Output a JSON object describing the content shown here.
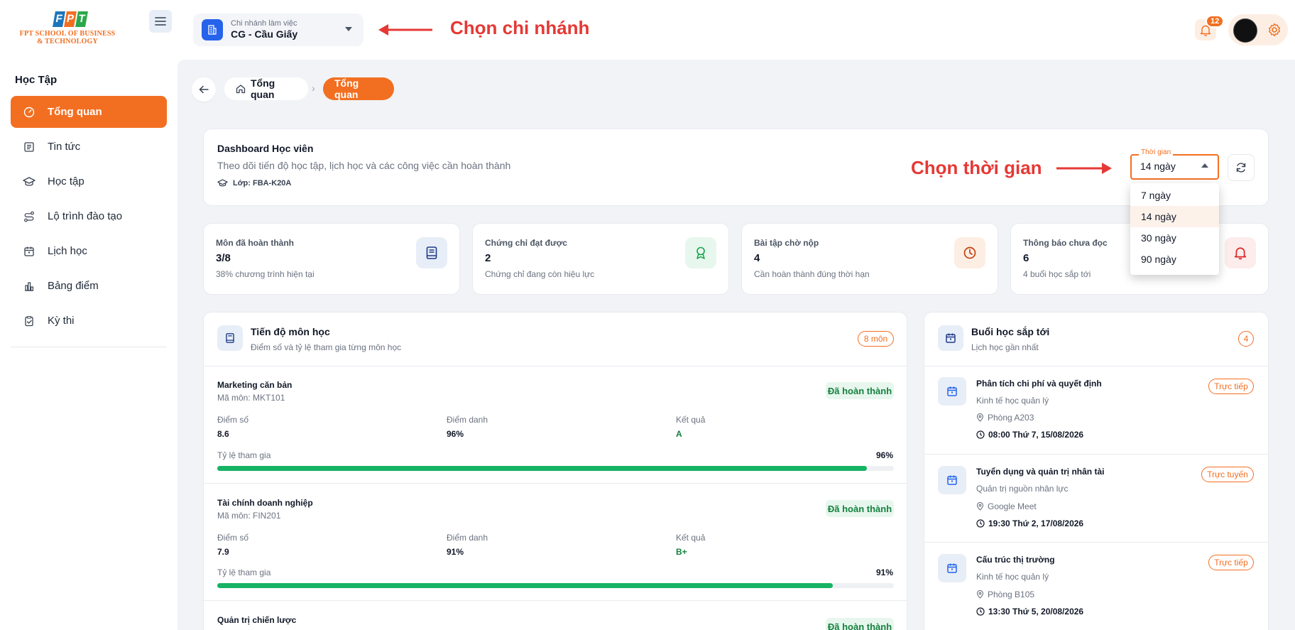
{
  "brand": {
    "logo_letters": [
      "F",
      "P",
      "T"
    ],
    "logo_letter_colors": [
      "#1b75bc",
      "#f26f21",
      "#2aa84a"
    ],
    "logo_text_line1": "FPT SCHOOL OF BUSINESS",
    "logo_text_line2": "& TECHNOLOGY"
  },
  "sidebar": {
    "section_title": "Học Tập",
    "items": [
      {
        "label": "Tổng quan",
        "icon": "gauge-icon",
        "active": true
      },
      {
        "label": "Tin tức",
        "icon": "news-icon"
      },
      {
        "label": "Học tập",
        "icon": "graduation-cap-icon"
      },
      {
        "label": "Lộ trình đào tạo",
        "icon": "route-icon"
      },
      {
        "label": "Lịch học",
        "icon": "calendar-icon"
      },
      {
        "label": "Bảng điểm",
        "icon": "bar-chart-icon"
      },
      {
        "label": "Kỳ thi",
        "icon": "clipboard-check-icon"
      }
    ]
  },
  "header": {
    "branch_label": "Chi nhánh làm việc",
    "branch_value": "CG - Cầu Giấy",
    "annotation_branch": "Chọn chi nhánh",
    "notification_count": "12"
  },
  "breadcrumb": {
    "home": "Tổng quan",
    "current": "Tổng quan"
  },
  "dashboard": {
    "title": "Dashboard Học viên",
    "subtitle": "Theo dõi tiến độ học tập, lịch học và các công việc cần hoàn thành",
    "class_label": "Lớp: FBA-K20A",
    "annotation_time": "Chọn thời gian",
    "time_legend": "Thời gian",
    "time_value": "14 ngày",
    "time_options": [
      "7 ngày",
      "14 ngày",
      "30 ngày",
      "90 ngày"
    ]
  },
  "stats": [
    {
      "label": "Môn đã hoàn thành",
      "value": "3/8",
      "desc": "38% chương trình hiện tại",
      "icon": "book-icon",
      "color": "#2563eb",
      "bg": "#e8eef7"
    },
    {
      "label": "Chứng chỉ đạt được",
      "value": "2",
      "desc": "Chứng chỉ đang còn hiệu lực",
      "icon": "award-icon",
      "color": "#16a34a",
      "bg": "#e7f7ee"
    },
    {
      "label": "Bài tập chờ nộp",
      "value": "4",
      "desc": "Cần hoàn thành đúng thời hạn",
      "icon": "clock-icon",
      "color": "#c2410c",
      "bg": "#fdeee4"
    },
    {
      "label": "Thông báo chưa đọc",
      "value": "6",
      "desc": "4 buổi học sắp tới",
      "icon": "bell-icon",
      "color": "#dc2626",
      "bg": "#fdecec"
    }
  ],
  "progress_panel": {
    "title": "Tiến độ môn học",
    "subtitle": "Điểm số và tỷ lệ tham gia từng môn học",
    "count_badge": "8 môn",
    "score_label": "Điểm số",
    "attendance_label": "Điểm danh",
    "result_label": "Kết quả",
    "participation_label": "Tỷ lệ tham gia",
    "courses": [
      {
        "name": "Marketing căn bản",
        "code": "Mã môn: MKT101",
        "status": "Đã hoàn thành",
        "score": "8.6",
        "attendance": "96%",
        "result": "A",
        "participation": "96%",
        "participation_value": 0.96
      },
      {
        "name": "Tài chính doanh nghiệp",
        "code": "Mã môn: FIN201",
        "status": "Đã hoàn thành",
        "score": "7.9",
        "attendance": "91%",
        "result": "B+",
        "participation": "91%",
        "participation_value": 0.91
      },
      {
        "name": "Quản trị chiến lược",
        "status": "Đã hoàn thành"
      }
    ]
  },
  "events_panel": {
    "title": "Buổi học sắp tới",
    "subtitle": "Lịch học gần nhất",
    "count_badge": "4",
    "events": [
      {
        "title": "Phân tích chi phí và quyết định",
        "subject": "Kinh tế học quản lý",
        "location": "Phòng A203",
        "time": "08:00 Thứ 7, 15/08/2026",
        "mode": "Trực tiếp"
      },
      {
        "title": "Tuyển dụng và quản trị nhân tài",
        "subject": "Quản trị nguồn nhân lực",
        "location": "Google Meet",
        "time": "19:30 Thứ 2, 17/08/2026",
        "mode": "Trực tuyến"
      },
      {
        "title": "Cấu trúc thị trường",
        "subject": "Kinh tế học quản lý",
        "location": "Phòng B105",
        "time": "13:30 Thứ 5, 20/08/2026",
        "mode": "Trực tiếp"
      }
    ]
  },
  "colors": {
    "accent": "#f26f21",
    "annotation": "#e53935",
    "success": "#16b364",
    "primary": "#2563eb"
  }
}
